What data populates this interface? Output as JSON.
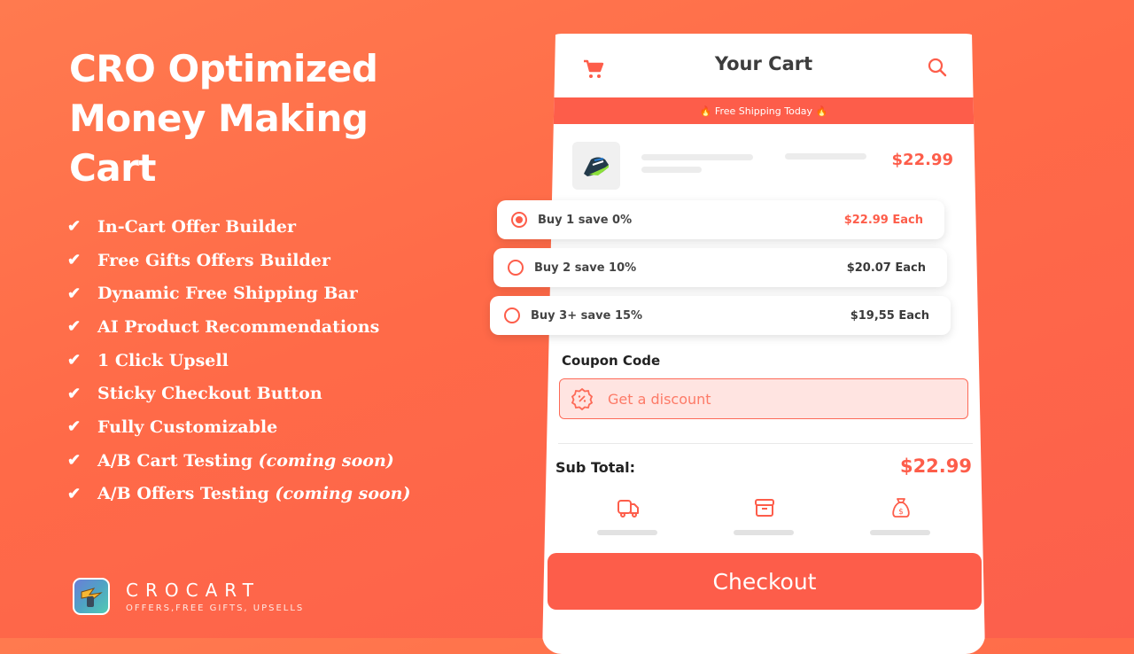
{
  "headline": [
    "CRO Optimized",
    "Money Making",
    "Cart"
  ],
  "features": [
    {
      "text": "In-Cart Offer Builder",
      "note": ""
    },
    {
      "text": "Free Gifts Offers Builder",
      "note": ""
    },
    {
      "text": "Dynamic Free Shipping Bar",
      "note": ""
    },
    {
      "text": "AI Product Recommendations",
      "note": ""
    },
    {
      "text": "1 Click Upsell",
      "note": ""
    },
    {
      "text": "Sticky Checkout Button",
      "note": ""
    },
    {
      "text": "Fully Customizable",
      "note": ""
    },
    {
      "text": "A/B Cart Testing ",
      "note": "(coming soon)"
    },
    {
      "text": "A/B Offers Testing ",
      "note": "(coming soon)"
    }
  ],
  "check_glyph": "✔",
  "brand": {
    "name": "CROCART",
    "tagline": "OFFERS,FREE GIFTS, UPSELLS",
    "logo_icon": "lightning-fist-icon"
  },
  "cart": {
    "title": "Your Cart",
    "shipping_banner": "🔥 Free Shipping Today 🔥",
    "product": {
      "image": "sneaker",
      "price": "$22.99"
    },
    "offers": [
      {
        "label": "Buy 1 save 0%",
        "price": "$22.99 Each",
        "selected": true
      },
      {
        "label": "Buy 2 save 10%",
        "price": "$20.07 Each",
        "selected": false
      },
      {
        "label": "Buy 3+ save 15%",
        "price": "$19,55 Each",
        "selected": false
      }
    ],
    "coupon": {
      "label": "Coupon Code",
      "placeholder": "Get a discount",
      "value": ""
    },
    "subtotal": {
      "label": "Sub Total:",
      "value": "$22.99"
    },
    "trust_icons": [
      "truck-icon",
      "archive-box-icon",
      "money-bag-icon"
    ],
    "checkout_label": "Checkout"
  },
  "colors": {
    "accent": "#fd5d4a",
    "background": "#ff6f4c",
    "coupon_bg": "#ffe4e1"
  }
}
